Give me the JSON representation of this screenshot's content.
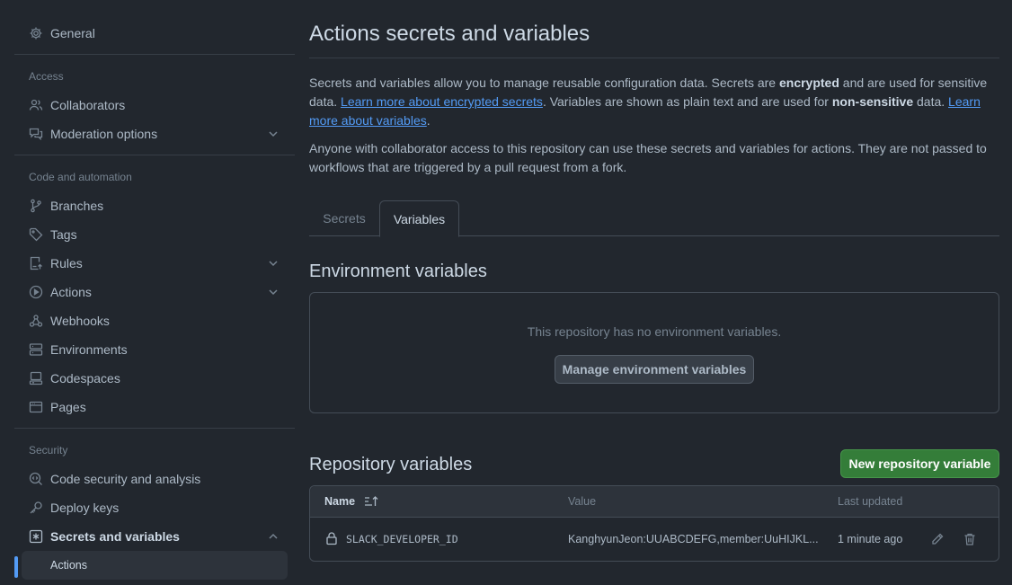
{
  "sidebar": {
    "general": "General",
    "sections": {
      "access": "Access",
      "code_automation": "Code and automation",
      "security": "Security"
    },
    "items": {
      "collaborators": "Collaborators",
      "moderation": "Moderation options",
      "branches": "Branches",
      "tags": "Tags",
      "rules": "Rules",
      "actions": "Actions",
      "webhooks": "Webhooks",
      "environments": "Environments",
      "codespaces": "Codespaces",
      "pages": "Pages",
      "code_security": "Code security and analysis",
      "deploy_keys": "Deploy keys",
      "secrets_variables": "Secrets and variables"
    },
    "sub_actions": "Actions"
  },
  "main": {
    "title": "Actions secrets and variables",
    "intro": {
      "p1_a": "Secrets and variables allow you to manage reusable configuration data. Secrets are ",
      "p1_b": "encrypted",
      "p1_c": " and are used for sensitive data. ",
      "link1": "Learn more about encrypted secrets",
      "p1_d": ". Variables are shown as plain text and are used for ",
      "p1_e": "non-sensitive",
      "p1_f": " data. ",
      "link2": "Learn more about variables",
      "p1_g": ".",
      "p2": "Anyone with collaborator access to this repository can use these secrets and variables for actions. They are not passed to workflows that are triggered by a pull request from a fork."
    },
    "tabs": {
      "secrets": "Secrets",
      "variables": "Variables"
    },
    "env": {
      "heading": "Environment variables",
      "empty": "This repository has no environment variables.",
      "manage_button": "Manage environment variables"
    },
    "repo": {
      "heading": "Repository variables",
      "new_button": "New repository variable",
      "columns": {
        "name": "Name",
        "value": "Value",
        "updated": "Last updated"
      },
      "rows": [
        {
          "name": "SLACK_DEVELOPER_ID",
          "value": "KanghyunJeon:UUABCDEFG,member:UuHIJKL...",
          "updated": "1 minute ago"
        }
      ]
    }
  },
  "colors": {
    "accent": "#539bf5",
    "primary_button": "#347d39",
    "background": "#22272e"
  }
}
